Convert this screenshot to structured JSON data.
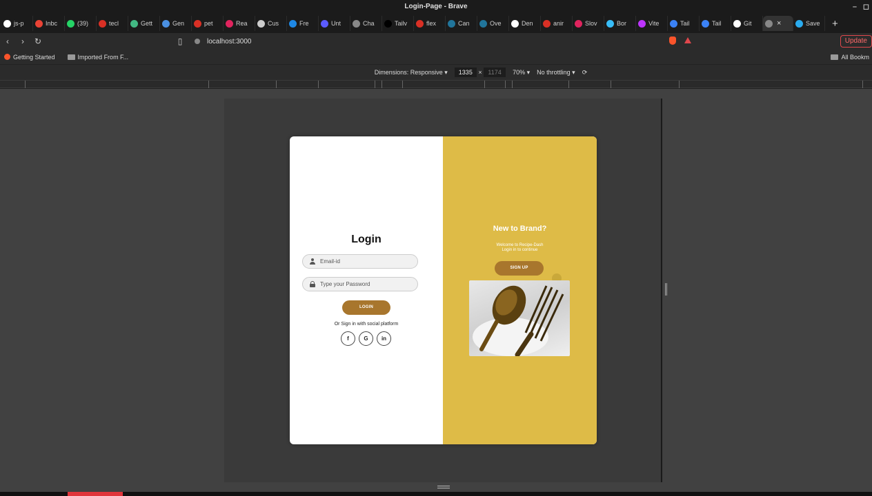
{
  "window": {
    "title": "Login-Page - Brave",
    "minimize": "–",
    "maximize": "◻"
  },
  "tabs": [
    {
      "label": "js-p",
      "color": "#ffffff"
    },
    {
      "label": "Inbc",
      "color": "#ea4335"
    },
    {
      "label": "(39)",
      "color": "#25d366"
    },
    {
      "label": "tecl",
      "color": "#d93025"
    },
    {
      "label": "Gett",
      "color": "#42b883"
    },
    {
      "label": "Gen",
      "color": "#4a90e2"
    },
    {
      "label": "pet",
      "color": "#d93025"
    },
    {
      "label": "Rea",
      "color": "#e0245e"
    },
    {
      "label": "Cus",
      "color": "#cccccc"
    },
    {
      "label": "Fre",
      "color": "#1e88e5"
    },
    {
      "label": "Unt",
      "color": "#5b5bff"
    },
    {
      "label": "Cha",
      "color": "#888888"
    },
    {
      "label": "Tailv",
      "color": "#000000"
    },
    {
      "label": "flex",
      "color": "#d93025"
    },
    {
      "label": "Can",
      "color": "#21759b"
    },
    {
      "label": "Ove",
      "color": "#21759b"
    },
    {
      "label": "Den",
      "color": "#ffffff"
    },
    {
      "label": "anir",
      "color": "#d93025"
    },
    {
      "label": "Slov",
      "color": "#e0245e"
    },
    {
      "label": "Bor",
      "color": "#38bdf8"
    },
    {
      "label": "Vite",
      "color": "#bd34fe"
    },
    {
      "label": "Tail",
      "color": "#3b82f6"
    },
    {
      "label": "Tail",
      "color": "#3b82f6"
    },
    {
      "label": "Git",
      "color": "#ffffff"
    }
  ],
  "active_tab": {
    "close": "×"
  },
  "saved_tab": {
    "label": "Save",
    "color": "#2aabee"
  },
  "new_tab": "+",
  "nav": {
    "back": "‹",
    "forward": "›",
    "reload": "↻",
    "bookmark": "▯"
  },
  "address": {
    "url": "localhost:3000",
    "update_label": "Update"
  },
  "bookmarks": {
    "items": [
      {
        "label": "Getting Started"
      },
      {
        "label": "Imported From F..."
      }
    ],
    "all_label": "All Bookm"
  },
  "devtools": {
    "dimensions_label": "Dimensions: Responsive ▾",
    "width": "1335",
    "sep": "×",
    "height": "1174",
    "zoom": "70% ▾",
    "throttle": "No throttling ▾",
    "rotate": "⟳"
  },
  "login": {
    "title": "Login",
    "email_placeholder": "Email-id",
    "password_placeholder": "Type your Password",
    "button": "LOGIN",
    "social_text": "Or Sign in with social platform",
    "social": [
      "f",
      "G",
      "in"
    ]
  },
  "signup": {
    "title": "New to Brand?",
    "line1": "Welcome to Recipe-Dash",
    "line2": "Login in to continue",
    "button": "SIGN UP"
  },
  "colors": {
    "panel": "#debb47",
    "button": "#a8762d"
  }
}
